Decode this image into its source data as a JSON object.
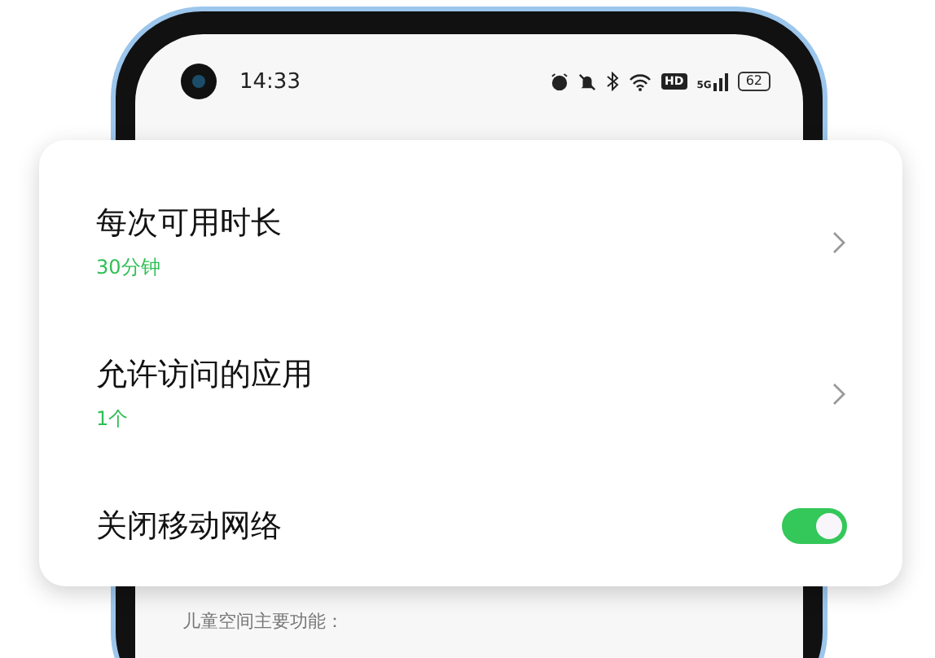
{
  "status_bar": {
    "time": "14:33",
    "hd_label": "HD",
    "network_label": "5G",
    "battery": "62"
  },
  "settings": [
    {
      "kind": "link",
      "title": "每次可用时长",
      "value": "30分钟"
    },
    {
      "kind": "link",
      "title": "允许访问的应用",
      "value": "1个"
    },
    {
      "kind": "toggle",
      "title": "关闭移动网络",
      "on": true
    }
  ],
  "background_text": "儿童空间主要功能："
}
